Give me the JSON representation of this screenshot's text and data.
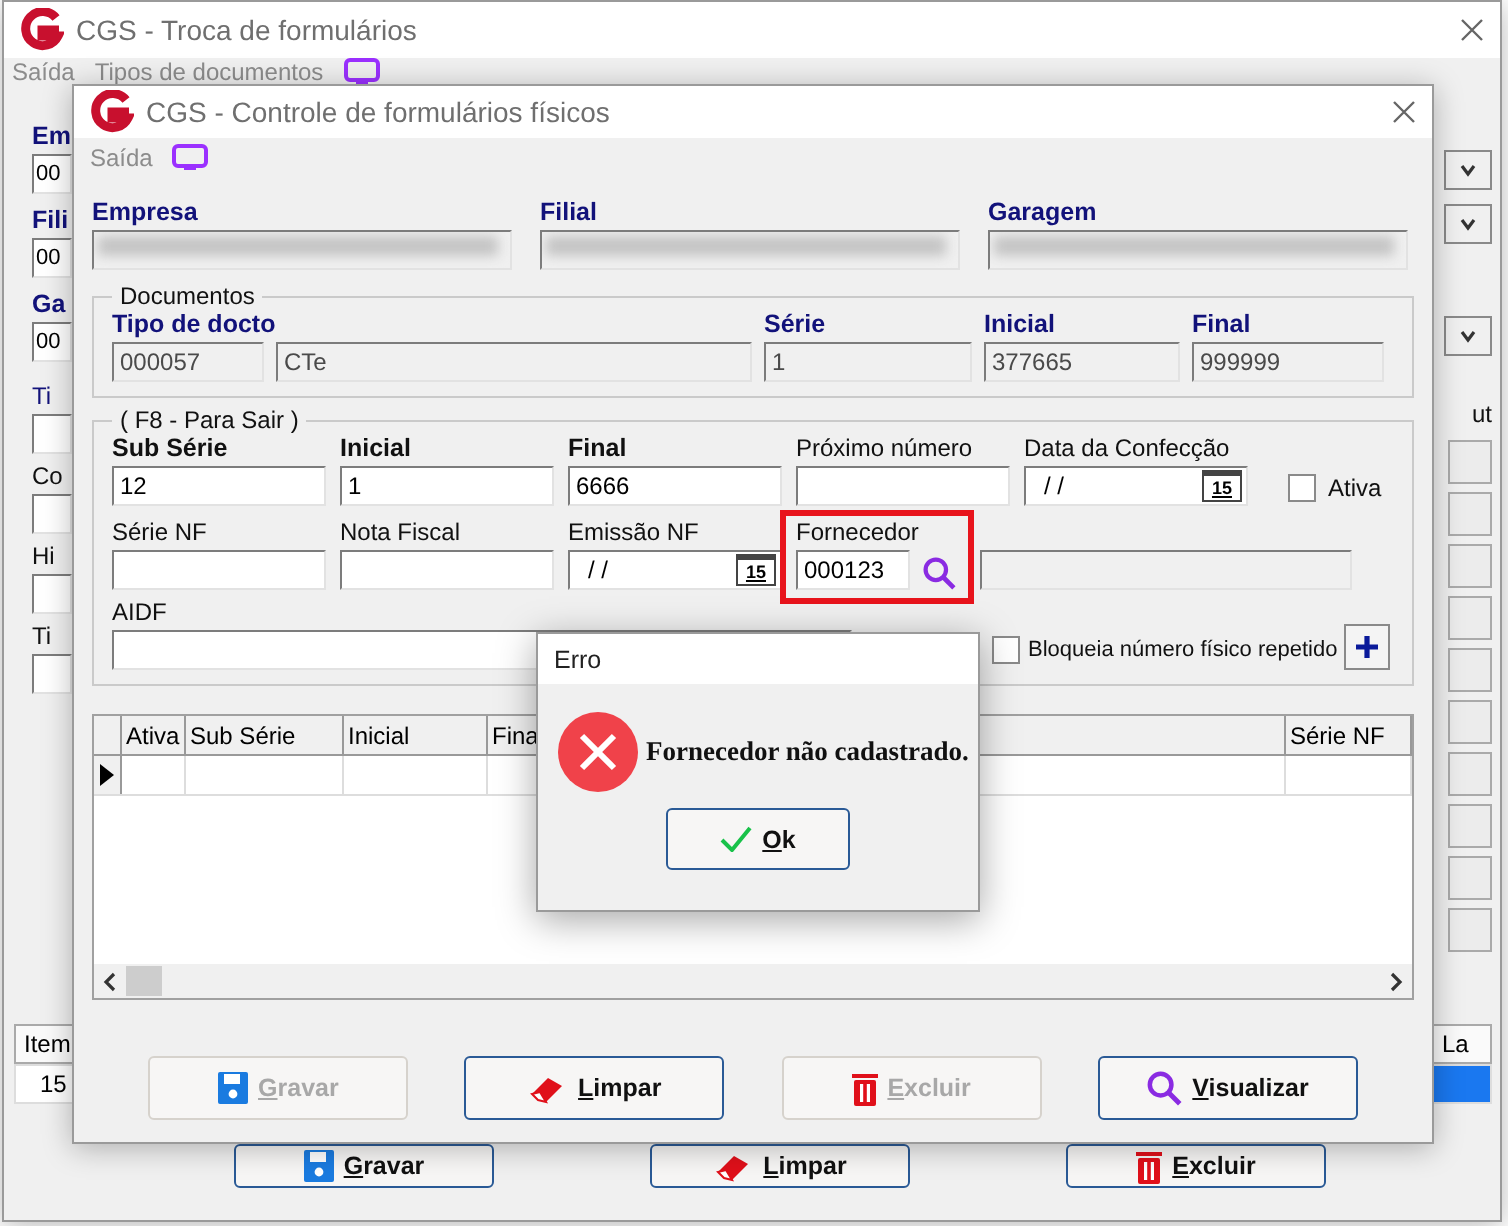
{
  "back_window": {
    "title": "CGS - Troca de formulários",
    "menu": [
      "Saída",
      "Tipos de documentos"
    ],
    "left_fields": [
      {
        "label": "Em",
        "value": "00"
      },
      {
        "label": "Fili",
        "value": "00"
      },
      {
        "label": "Ga",
        "value": "00"
      }
    ],
    "left_lower": [
      "Ti",
      "Co",
      "Hi",
      "Ti"
    ],
    "right_label": "ut",
    "grid": {
      "columns": [
        "Item",
        "La"
      ],
      "cell": "15"
    },
    "buttons": [
      {
        "label": "Gravar",
        "kind": "save",
        "disabled": false
      },
      {
        "label": "Limpar",
        "kind": "eraser",
        "disabled": false
      },
      {
        "label": "Excluir",
        "kind": "trash",
        "disabled": false
      }
    ]
  },
  "window": {
    "title": "CGS - Controle de formulários físicos",
    "menu": [
      "Saída"
    ],
    "header_fields": [
      {
        "label": "Empresa",
        "blurred": true
      },
      {
        "label": "Filial",
        "blurred": true
      },
      {
        "label": "Garagem",
        "blurred": true
      }
    ],
    "documentos": {
      "title": "Documentos",
      "fields": [
        {
          "label": "Tipo de docto",
          "value": "000057"
        },
        {
          "value": "CTe"
        },
        {
          "label": "Série",
          "value": "1"
        },
        {
          "label": "Inicial",
          "value": "377665"
        },
        {
          "label": "Final",
          "value": "999999"
        }
      ]
    },
    "f8": {
      "title": "( F8 - Para Sair )",
      "row1": [
        {
          "label": "Sub Série",
          "bold": true,
          "kind": "text",
          "value": "12"
        },
        {
          "label": "Inicial",
          "bold": true,
          "kind": "text",
          "value": "1"
        },
        {
          "label": "Final",
          "bold": true,
          "kind": "text",
          "value": "6666"
        },
        {
          "label": "Próximo número",
          "bold": false,
          "kind": "text"
        },
        {
          "label": "Data da Confecção",
          "bold": false,
          "kind": "date",
          "value": "/ /",
          "picker": "15"
        }
      ],
      "ativa": {
        "label": "Ativa",
        "checked": false
      },
      "row2": [
        {
          "label": "Série NF",
          "bold": false,
          "kind": "text"
        },
        {
          "label": "Nota Fiscal",
          "bold": false,
          "kind": "text"
        },
        {
          "label": "Emissão NF",
          "bold": false,
          "kind": "date",
          "value": "/ /",
          "picker": "15"
        },
        {
          "label": "Fornecedor",
          "bold": false,
          "kind": "lookup",
          "value": "000123",
          "highlighted": true
        },
        {
          "kind": "readonly"
        }
      ],
      "aidf": {
        "label": "AIDF"
      },
      "bloqueia": {
        "label": "Bloqueia número físico repetido",
        "checked": false
      }
    },
    "table": {
      "columns": [
        "Ativa",
        "Sub Série",
        "Inicial",
        "Fina",
        "Série NF"
      ]
    },
    "buttons": [
      {
        "label": "Gravar",
        "kind": "save",
        "disabled": true
      },
      {
        "label": "Limpar",
        "kind": "eraser",
        "disabled": false
      },
      {
        "label": "Excluir",
        "kind": "trash",
        "disabled": true
      },
      {
        "label": "Visualizar",
        "kind": "search",
        "disabled": false
      }
    ]
  },
  "error_dialog": {
    "title": "Erro",
    "message": "Fornecedor não cadastrado.",
    "button": {
      "label": "Ok",
      "kind": "check"
    }
  }
}
